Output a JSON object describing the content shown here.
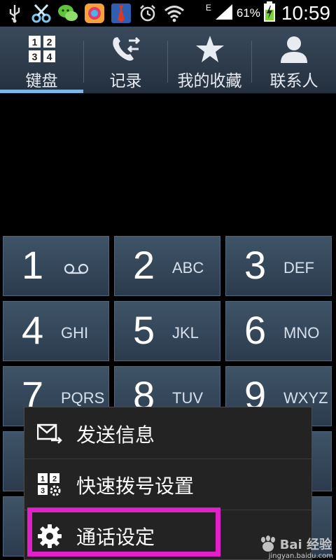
{
  "status_bar": {
    "battery": "61%",
    "time": "10:59",
    "network": "E",
    "icons": [
      "usb-icon",
      "scissors-icon",
      "wechat-icon",
      "app-store-icon",
      "tie-icon",
      "alarm-icon",
      "wifi-icon",
      "signal-icon",
      "battery-charging-icon"
    ]
  },
  "tabs": [
    {
      "label": "键盘",
      "icon": "keypad-icon",
      "active": true
    },
    {
      "label": "记录",
      "icon": "call-log-icon",
      "active": false
    },
    {
      "label": "我的收藏",
      "icon": "star-icon",
      "active": false
    },
    {
      "label": "联系人",
      "icon": "person-icon",
      "active": false
    }
  ],
  "keys": [
    {
      "digit": "1",
      "letters": "",
      "icon": "voicemail-icon"
    },
    {
      "digit": "2",
      "letters": "ABC"
    },
    {
      "digit": "3",
      "letters": "DEF"
    },
    {
      "digit": "4",
      "letters": "GHI"
    },
    {
      "digit": "5",
      "letters": "JKL"
    },
    {
      "digit": "6",
      "letters": "MNO"
    },
    {
      "digit": "7",
      "letters": "PQRS"
    },
    {
      "digit": "8",
      "letters": "TUV"
    },
    {
      "digit": "9",
      "letters": "WXYZ"
    }
  ],
  "menu": {
    "items": [
      {
        "label": "发送信息",
        "icon": "message-send-icon"
      },
      {
        "label": "快速拨号设置",
        "icon": "speed-dial-settings-icon"
      },
      {
        "label": "通话设定",
        "icon": "gear-icon"
      }
    ]
  },
  "watermark": {
    "text": "Bai 经验",
    "sub": "jingyan.baidu.com"
  },
  "colors": {
    "highlight": "#e020c8",
    "tab_active": "#7fb6e8",
    "key_bg": "#34475a"
  }
}
